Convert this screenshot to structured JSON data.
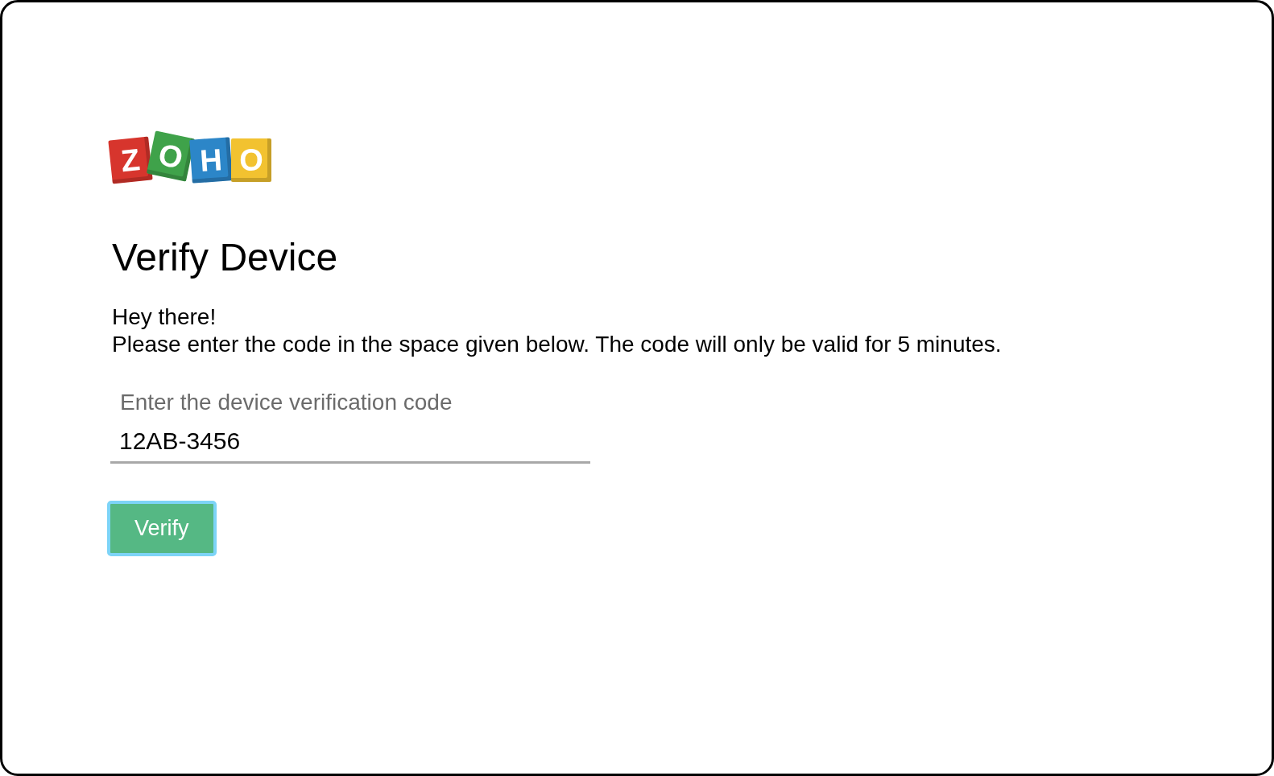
{
  "logo": {
    "letters": [
      {
        "text": "Z",
        "color": "#d7352d"
      },
      {
        "text": "O",
        "color": "#3fa24a"
      },
      {
        "text": "H",
        "color": "#2c86c8"
      },
      {
        "text": "O",
        "color": "#f2c230"
      }
    ]
  },
  "heading": "Verify Device",
  "greeting": "Hey there!",
  "message": "Please enter the code in the space given below. The code will only be valid for 5 minutes.",
  "code_field": {
    "label": "Enter the device verification code",
    "value": "12AB-3456"
  },
  "verify_button": {
    "label": "Verify"
  }
}
